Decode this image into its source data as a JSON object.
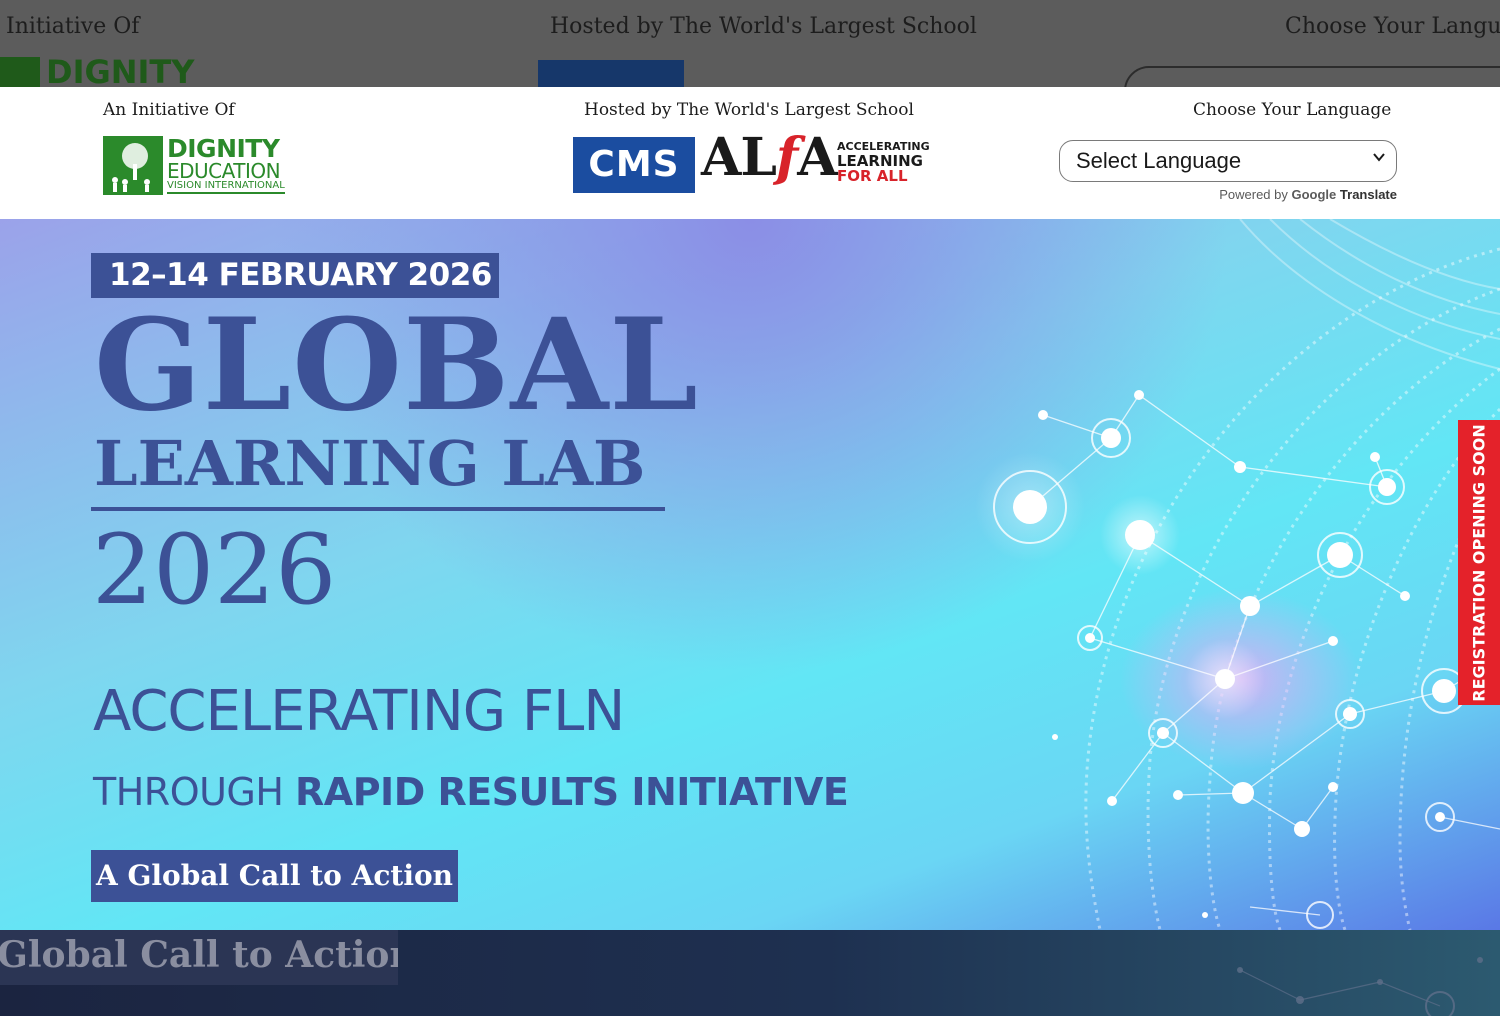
{
  "background": {
    "initiative_label": "Initiative Of",
    "hosted_label": "Hosted by The World's Largest School",
    "language_label": "Choose Your Langua",
    "cta_label": "Global Call to Action",
    "dignity_word": "DIGNITY"
  },
  "header": {
    "initiative_label": "An Initiative Of",
    "hosted_label": "Hosted by The World's Largest School",
    "language_label": "Choose Your Language",
    "dignity_logo": {
      "line1": "DIGNITY",
      "line2": "EDUCATION",
      "line3": "VISION INTERNATIONAL"
    },
    "cms_logo": "CMS",
    "alfa_logo": {
      "prefix": "AL",
      "f": "f",
      "suffix": "A",
      "tag1": "ACCELERATING",
      "tag2": "LEARNING",
      "tag3": "FOR ALL"
    },
    "language_select": {
      "value": "Select Language"
    },
    "powered_by": {
      "prefix": "Powered by",
      "brand": "Google",
      "suffix": "Translate"
    }
  },
  "banner": {
    "date": "12–14 FEBRUARY 2026",
    "title_line1": "GLOBAL",
    "title_line2": "LEARNING LAB",
    "title_year": "2026",
    "subtitle": "ACCELERATING FLN",
    "tagline_prefix": "THROUGH",
    "tagline_bold": "RAPID RESULTS INITIATIVE",
    "cta_button": "A Global Call to Action",
    "registration_tab": "REGISTRATION OPENING SOON"
  },
  "colors": {
    "brand_navy": "#3c5196",
    "dignity_green": "#2b8a2b",
    "cms_blue": "#1b4da0",
    "alfa_red": "#d8232a",
    "registration_red": "#e4222a"
  }
}
